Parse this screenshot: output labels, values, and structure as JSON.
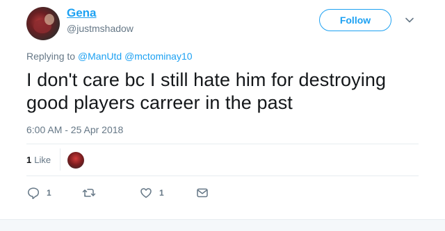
{
  "author": {
    "name": "Gena",
    "handle": "@justmshadow"
  },
  "follow_button": {
    "label": "Follow"
  },
  "menu": {
    "icon": "chevron-down-icon"
  },
  "reply_context": {
    "prefix": "Replying to",
    "mentions": [
      "@ManUtd",
      "@mctominay10"
    ]
  },
  "tweet": {
    "text": "I don't care bc I still hate him for destroying good players carreer in the past",
    "timestamp": "6:00 AM - 25 Apr 2018"
  },
  "stats": {
    "likes_count": "1",
    "likes_label": "Like"
  },
  "actions": {
    "reply": {
      "icon": "reply-icon",
      "count": "1"
    },
    "retweet": {
      "icon": "retweet-icon",
      "count": ""
    },
    "like": {
      "icon": "heart-icon",
      "count": "1"
    },
    "dm": {
      "icon": "envelope-icon"
    }
  },
  "colors": {
    "accent": "#1da1f2",
    "muted": "#657786",
    "text": "#14171a",
    "divider": "#e6ecf0"
  }
}
